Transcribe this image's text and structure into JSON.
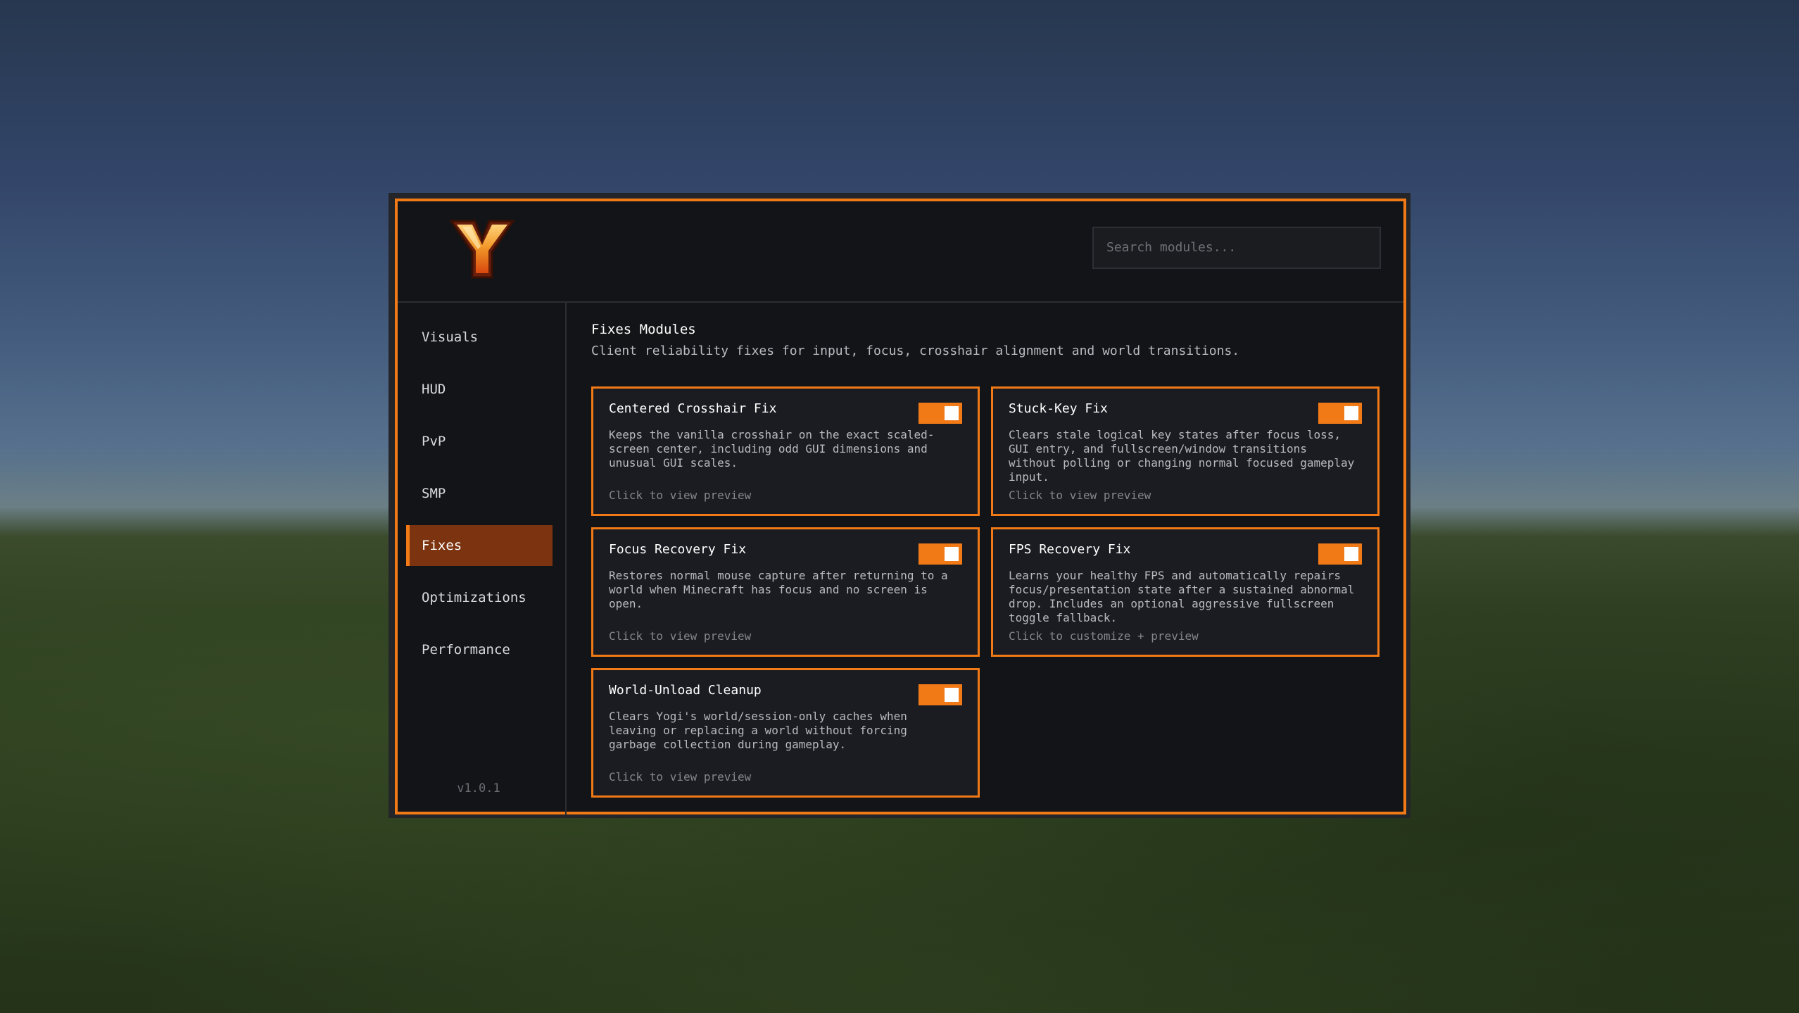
{
  "search": {
    "placeholder": "Search modules..."
  },
  "sidebar": {
    "items": [
      {
        "label": "Visuals",
        "active": false
      },
      {
        "label": "HUD",
        "active": false
      },
      {
        "label": "PvP",
        "active": false
      },
      {
        "label": "SMP",
        "active": false
      },
      {
        "label": "Fixes",
        "active": true
      },
      {
        "label": "Optimizations",
        "active": false
      },
      {
        "label": "Performance",
        "active": false
      }
    ],
    "version": "v1.0.1"
  },
  "content": {
    "title": "Fixes Modules",
    "subtitle": "Client reliability fixes for input, focus, crosshair alignment and world transitions."
  },
  "modules": [
    {
      "title": "Centered Crosshair Fix",
      "enabled": true,
      "description": "Keeps the vanilla crosshair on the exact scaled-screen center, including odd GUI dimensions and unusual GUI scales.",
      "link": "Click to view preview"
    },
    {
      "title": "Stuck-Key Fix",
      "enabled": true,
      "description": "Clears stale logical key states after focus loss, GUI entry, and fullscreen/window transitions without polling or changing normal focused gameplay input.",
      "link": "Click to view preview"
    },
    {
      "title": "Focus Recovery Fix",
      "enabled": true,
      "description": "Restores normal mouse capture after returning to a world when Minecraft has focus and no screen is open.",
      "link": "Click to view preview"
    },
    {
      "title": "FPS Recovery Fix",
      "enabled": true,
      "description": "Learns your healthy FPS and automatically repairs focus/presentation state after a sustained abnormal drop. Includes an optional aggressive fullscreen toggle fallback.",
      "link": "Click to customize + preview"
    },
    {
      "title": "World-Unload Cleanup",
      "enabled": true,
      "description": "Clears Yogi's world/session-only caches when leaving or replacing a world without forcing garbage collection during gameplay.",
      "link": "Click to view preview"
    }
  ],
  "colors": {
    "accent": "#f27a16",
    "active_bg": "#7c330f",
    "panel_bg": "#131417",
    "card_bg": "#1b1c21"
  },
  "icons": {
    "logo": "y-logo-icon"
  }
}
